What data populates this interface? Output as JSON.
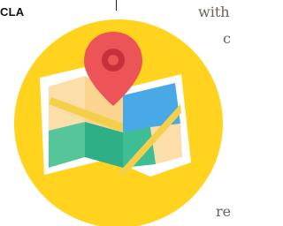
{
  "header": {
    "corner_label": "CLA"
  },
  "background_text": {
    "top": "with",
    "middle": "c",
    "bottom": "re"
  },
  "icon": {
    "name": "map-location-icon",
    "colors": {
      "circle": "#FFD31E",
      "map_frame": "#FFFFFF",
      "map_tan": "#FCDFA8",
      "map_green": "#3FBD94",
      "map_blue": "#48A9E6",
      "road": "#F4D04A",
      "pin": "#EC5457",
      "pin_center": "#C72F3B"
    }
  }
}
